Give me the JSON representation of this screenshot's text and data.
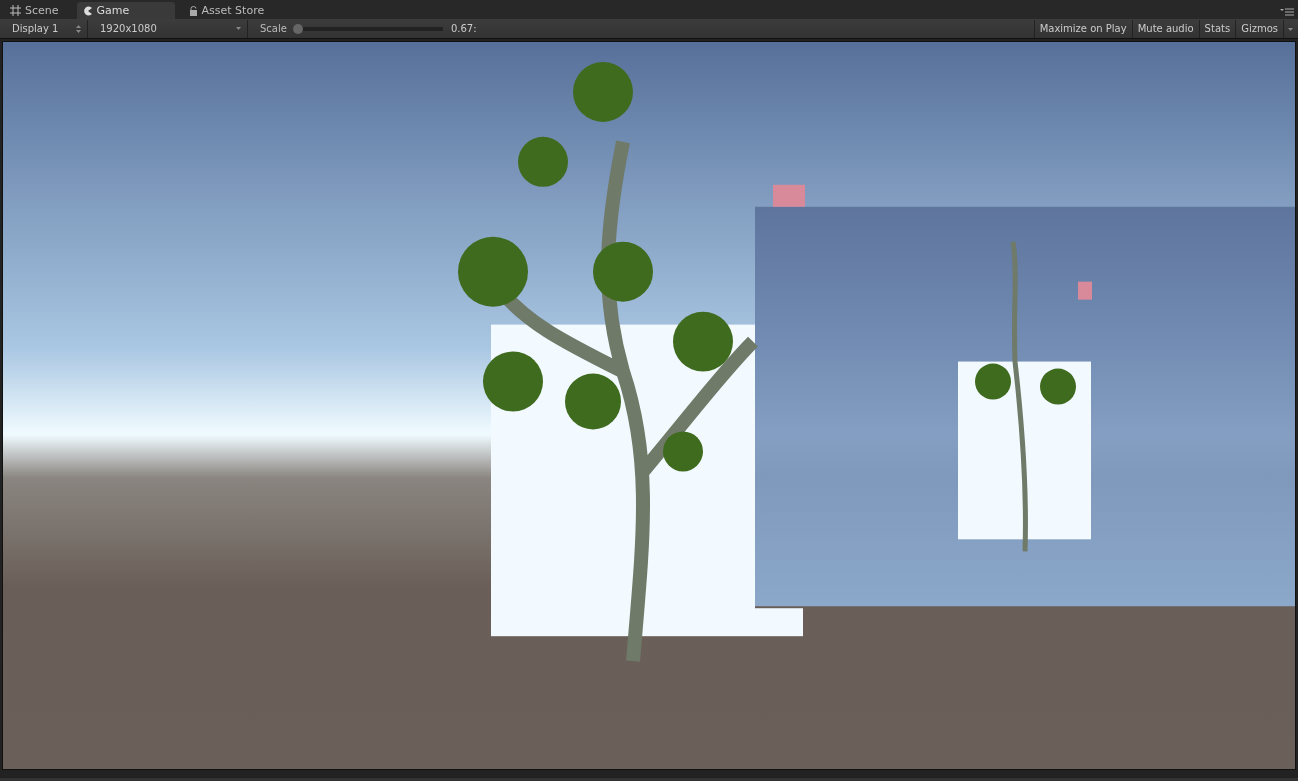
{
  "tabs": [
    {
      "label": "Scene",
      "kind": "scene",
      "selected": false
    },
    {
      "label": "Game",
      "kind": "game",
      "selected": true
    },
    {
      "label": "Asset Store",
      "kind": "store",
      "selected": false
    }
  ],
  "toolbar": {
    "display": "Display 1",
    "resolution": "1920x1080",
    "scale_label": "Scale",
    "scale": {
      "level": 0.0
    },
    "scale_reading": "0.67:",
    "toggles": [
      {
        "label": "Maximize on Play",
        "on": false
      },
      {
        "label": "Mute audio",
        "on": false
      },
      {
        "label": "Stats",
        "on": false
      },
      {
        "label": "Gizmos",
        "on": false
      }
    ]
  }
}
